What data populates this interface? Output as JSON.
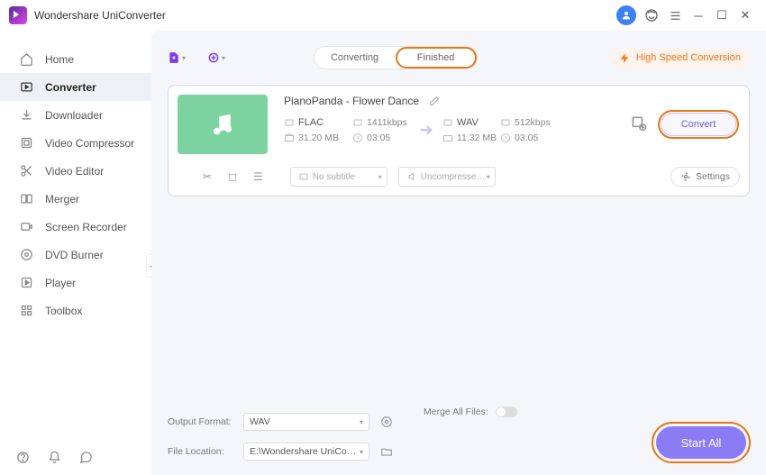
{
  "app": {
    "title": "Wondershare UniConverter"
  },
  "sidebar": {
    "items": [
      {
        "label": "Home"
      },
      {
        "label": "Converter"
      },
      {
        "label": "Downloader"
      },
      {
        "label": "Video Compressor"
      },
      {
        "label": "Video Editor"
      },
      {
        "label": "Merger"
      },
      {
        "label": "Screen Recorder"
      },
      {
        "label": "DVD Burner"
      },
      {
        "label": "Player"
      },
      {
        "label": "Toolbox"
      }
    ]
  },
  "toolbar": {
    "tab_converting": "Converting",
    "tab_finished": "Finished",
    "high_speed": "High Speed Conversion"
  },
  "file": {
    "title": "PianoPanda - Flower Dance",
    "src": {
      "format": "FLAC",
      "bitrate": "1411kbps",
      "size": "31.20 MB",
      "duration": "03:05"
    },
    "dst": {
      "format": "WAV",
      "bitrate": "512kbps",
      "size": "11.32 MB",
      "duration": "03:05"
    },
    "convert_label": "Convert",
    "subtitle_dd": "No subtitle",
    "audio_dd": "Uncompresse…",
    "settings_label": "Settings"
  },
  "footer": {
    "output_format_label": "Output Format:",
    "output_format_value": "WAV",
    "file_location_label": "File Location:",
    "file_location_value": "E:\\Wondershare UniConverter",
    "merge_label": "Merge All Files:",
    "start_all": "Start All"
  }
}
